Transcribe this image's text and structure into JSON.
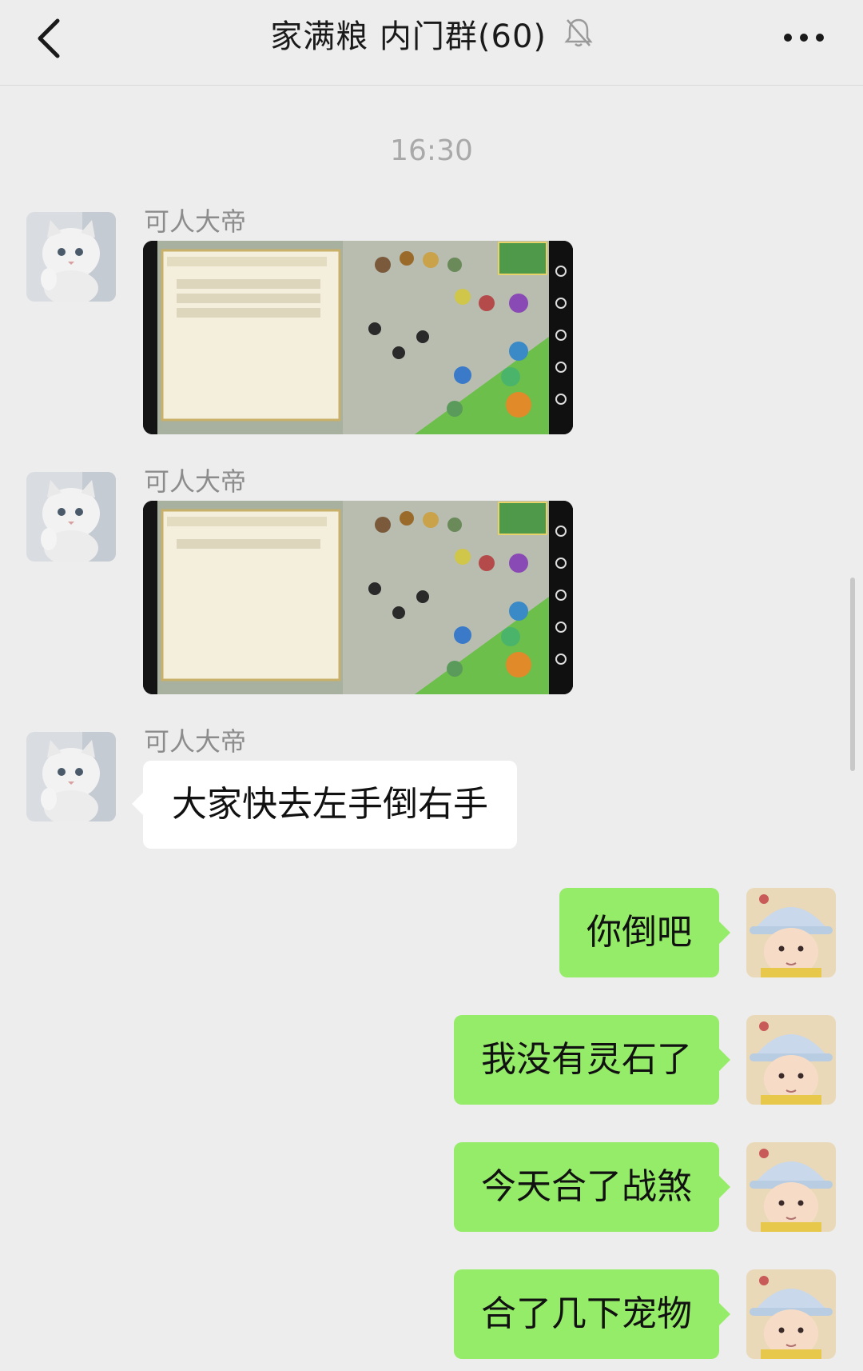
{
  "header": {
    "title": "家满粮 内门群(60)",
    "back_icon": "chevron-left-icon",
    "mute_icon": "bell-off-icon",
    "more_icon": "ellipsis-icon"
  },
  "timestamp": "16:30",
  "messages": [
    {
      "side": "left",
      "sender": "可人大帝",
      "type": "image",
      "image_desc": "game-screenshot-trade-3-items"
    },
    {
      "side": "left",
      "sender": "可人大帝",
      "type": "image",
      "image_desc": "game-screenshot-trade-1-item"
    },
    {
      "side": "left",
      "sender": "可人大帝",
      "type": "text",
      "text": "大家快去左手倒右手"
    },
    {
      "side": "right",
      "type": "text",
      "text": "你倒吧"
    },
    {
      "side": "right",
      "type": "text",
      "text": "我没有灵石了"
    },
    {
      "side": "right",
      "type": "text",
      "text": "今天合了战煞"
    },
    {
      "side": "right",
      "type": "text",
      "text": "合了几下宠物"
    }
  ],
  "colors": {
    "background": "#ededed",
    "bubble_self": "#95ec69",
    "bubble_other": "#ffffff",
    "meta_text": "#8c8c8c"
  }
}
